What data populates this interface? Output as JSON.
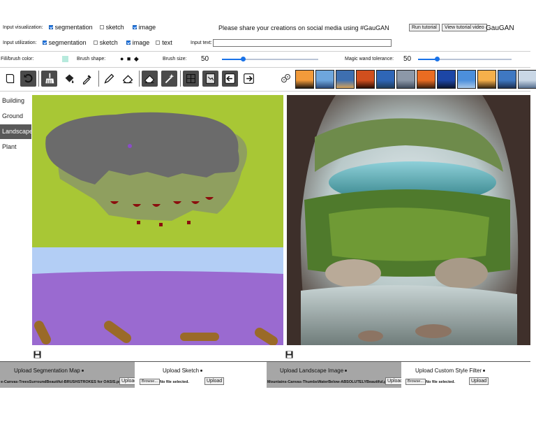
{
  "header": {
    "input_visualization_label": "Input visualization:",
    "input_utilization_label": "Input utilization:",
    "vis_options": [
      {
        "label": "segmentation",
        "checked": true
      },
      {
        "label": "sketch",
        "checked": false
      },
      {
        "label": "image",
        "checked": true
      }
    ],
    "util_options": [
      {
        "label": "segmentation",
        "checked": true
      },
      {
        "label": "sketch",
        "checked": false
      },
      {
        "label": "image",
        "checked": true
      },
      {
        "label": "text",
        "checked": false
      }
    ],
    "share_message": "Please share your creations on social media using #GauGAN",
    "input_text_label": "Input text:",
    "input_text_value": "",
    "run_tutorial": "Run tutorial",
    "view_tutorial_video": "View tutorial video",
    "app_title": "GauGAN"
  },
  "brush": {
    "fill_color_label": "Fill/brush color:",
    "fill_color": "#b7eadd",
    "shape_label": "Brush shape:",
    "shape_symbols": "● ■ ◆",
    "size_label": "Brush size:",
    "size_value": "50",
    "size_fraction": 0.22,
    "magic_label": "Magic wand tolerance:",
    "magic_value": "50",
    "magic_fraction": 0.2
  },
  "toolbar": {
    "tools": [
      {
        "name": "page-icon",
        "dark": false
      },
      {
        "name": "undo-icon",
        "dark": true
      },
      {
        "name": "broom-icon",
        "dark": true
      },
      {
        "name": "paint-bucket-icon",
        "dark": false
      },
      {
        "name": "eyedropper-icon",
        "dark": false
      },
      {
        "name": "pencil-icon",
        "dark": false
      },
      {
        "name": "eraser-icon",
        "dark": false
      },
      {
        "name": "eraser-filled-icon",
        "dark": true
      },
      {
        "name": "magic-wand-icon",
        "dark": true
      },
      {
        "name": "grid-icon",
        "dark": true
      },
      {
        "name": "document-scan-icon",
        "dark": true
      },
      {
        "name": "arrow-left-box-icon",
        "dark": true
      },
      {
        "name": "arrow-right-box-icon",
        "dark": false
      }
    ],
    "dice_icon": "dice-icon",
    "style_thumbnails": [
      {
        "sky": "#f29b3b",
        "ground": "#21180f"
      },
      {
        "sky": "#6ea6dd",
        "ground": "#2b4a7a"
      },
      {
        "sky": "#3e6fb0",
        "ground": "#d7a35a"
      },
      {
        "sky": "#d14f1e",
        "ground": "#2a0d05"
      },
      {
        "sky": "#2f66b7",
        "ground": "#1f3c5c"
      },
      {
        "sky": "#8c98a8",
        "ground": "#3d4a5b"
      },
      {
        "sky": "#e96c22",
        "ground": "#3c1f0e"
      },
      {
        "sky": "#1c46a6",
        "ground": "#0b1631"
      },
      {
        "sky": "#4c8fdc",
        "ground": "#a8c8e8"
      },
      {
        "sky": "#f6b04b",
        "ground": "#3a2712"
      },
      {
        "sky": "#3f78c2",
        "ground": "#1b2f52"
      },
      {
        "sky": "#c9d7e6",
        "ground": "#57708f"
      }
    ]
  },
  "categories": {
    "items": [
      "Building",
      "Ground",
      "Landscape",
      "Plant"
    ],
    "active_index": 2
  },
  "canvas": {
    "save_icon": "floppy-disk-icon",
    "colors": {
      "sky": "#a8c735",
      "cloud": "#6b6b6b",
      "grass": "#8f9f5f",
      "flower": "#8b0e0e",
      "water": "#b3cef5",
      "ground": "#9a6ad0",
      "dirt": "#9a6a28"
    }
  },
  "output": {
    "save_icon": "floppy-disk-icon"
  },
  "uploads": [
    {
      "title": "Upload Segmentation Map",
      "filename": "e-Canvas-TreesSurroundBeautiful-BRUSHSTROKES for OASIS.png",
      "button": "Upload",
      "style": "gray"
    },
    {
      "title": "Upload Sketch",
      "browse": "Browse...",
      "nofile": "No file selected.",
      "button": "Upload",
      "style": "white"
    },
    {
      "title": "Upload Landscape Image",
      "filename": "Mountains-Canvas-ThumbsWaterBelow-ABSOLUTELYBeautiful.png",
      "button": "Upload",
      "style": "gray"
    },
    {
      "title": "Upload Custom Style Filter",
      "browse": "Browse...",
      "nofile": "No file selected.",
      "button": "Upload",
      "style": "white"
    }
  ]
}
